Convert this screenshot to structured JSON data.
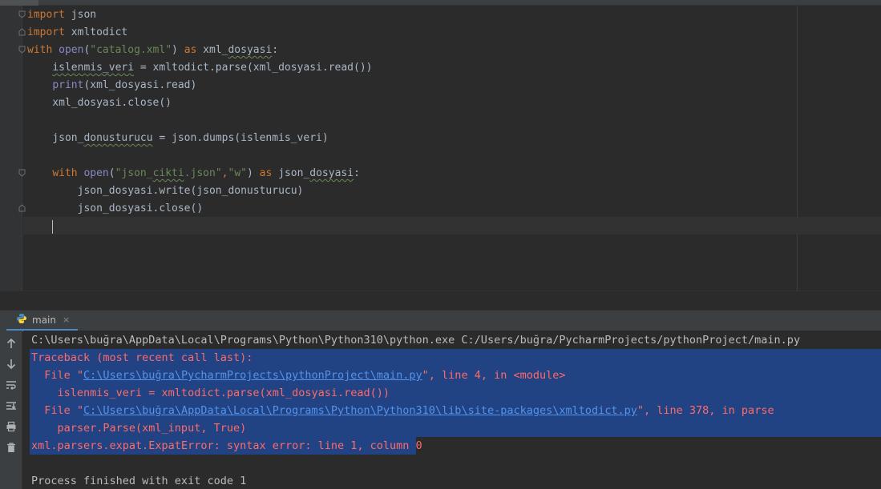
{
  "editor": {
    "lines": [
      [
        {
          "t": "import",
          "c": "kw"
        },
        {
          "t": " json",
          "c": ""
        }
      ],
      [
        {
          "t": "import",
          "c": "kw"
        },
        {
          "t": " xmltodict",
          "c": ""
        }
      ],
      [
        {
          "t": "with",
          "c": "kw"
        },
        {
          "t": " ",
          "c": ""
        },
        {
          "t": "open",
          "c": "bi"
        },
        {
          "t": "(",
          "c": ""
        },
        {
          "t": "\"catalog.xml\"",
          "c": "str"
        },
        {
          "t": ") ",
          "c": ""
        },
        {
          "t": "as",
          "c": "kw"
        },
        {
          "t": " xml_",
          "c": ""
        },
        {
          "t": "dosyasi",
          "c": "squig"
        },
        {
          "t": ":",
          "c": ""
        }
      ],
      [
        {
          "t": "    ",
          "c": ""
        },
        {
          "t": "islenmis_veri",
          "c": "squig"
        },
        {
          "t": " = xmltodict.parse(xml_dosyasi.read())",
          "c": ""
        }
      ],
      [
        {
          "t": "    ",
          "c": ""
        },
        {
          "t": "print",
          "c": "bi"
        },
        {
          "t": "(xml_dosyasi.read)",
          "c": ""
        }
      ],
      [
        {
          "t": "    xml_dosyasi.close()",
          "c": ""
        }
      ],
      [
        {
          "t": "",
          "c": ""
        }
      ],
      [
        {
          "t": "    json_",
          "c": ""
        },
        {
          "t": "donusturucu",
          "c": "squig"
        },
        {
          "t": " = json.dumps(islenmis_veri)",
          "c": ""
        }
      ],
      [
        {
          "t": "",
          "c": ""
        }
      ],
      [
        {
          "t": "    ",
          "c": ""
        },
        {
          "t": "with",
          "c": "kw"
        },
        {
          "t": " ",
          "c": ""
        },
        {
          "t": "open",
          "c": "bi"
        },
        {
          "t": "(",
          "c": ""
        },
        {
          "t": "\"json_",
          "c": "str"
        },
        {
          "t": "cikti",
          "c": "str squig"
        },
        {
          "t": ".json\"",
          "c": "str"
        },
        {
          "t": ",",
          "c": "kw"
        },
        {
          "t": "\"w\"",
          "c": "str"
        },
        {
          "t": ") ",
          "c": ""
        },
        {
          "t": "as",
          "c": "kw"
        },
        {
          "t": " json_",
          "c": ""
        },
        {
          "t": "dosyasi",
          "c": "squig"
        },
        {
          "t": ":",
          "c": ""
        }
      ],
      [
        {
          "t": "        json_dosyasi.write(json_donusturucu)",
          "c": ""
        }
      ],
      [
        {
          "t": "        json_dosyasi.close()",
          "c": ""
        }
      ]
    ]
  },
  "run": {
    "tab_label": "main",
    "tab_close": "×",
    "toolbar_icons": [
      "up-arrow-icon",
      "down-arrow-icon",
      "soft-wrap-icon",
      "scroll-to-end-icon",
      "print-icon",
      "trash-icon"
    ]
  },
  "console": {
    "command": "C:\\Users\\buğra\\AppData\\Local\\Programs\\Python\\Python310\\python.exe C:/Users/buğra/PycharmProjects/pythonProject/main.py",
    "traceback_header": "Traceback (most recent call last):",
    "frame1": {
      "prefix": "  File \"",
      "path": "C:\\Users\\buğra\\PycharmProjects\\pythonProject\\main.py",
      "suffix": "\", line 4, in <module>"
    },
    "frame1_code": "    islenmis_veri = xmltodict.parse(xml_dosyasi.read())",
    "frame2": {
      "prefix": "  File \"",
      "path": "C:\\Users\\buğra\\AppData\\Local\\Programs\\Python\\Python310\\lib\\site-packages\\xmltodict.py",
      "suffix": "\", line 378, in parse"
    },
    "frame2_code": "    parser.Parse(xml_input, True)",
    "error": "xml.parsers.expat.ExpatError: syntax error: line 1, column 0",
    "exit": "Process finished with exit code 1"
  },
  "colors": {
    "keyword": "#cc7832",
    "builtin": "#8888c6",
    "string": "#6a8759",
    "error_text": "#ff6b68",
    "link": "#5394ec",
    "selection": "#214283"
  }
}
